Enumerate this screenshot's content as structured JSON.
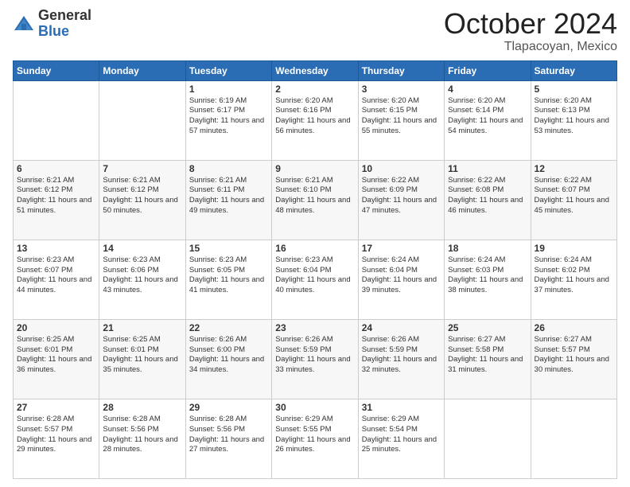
{
  "header": {
    "logo_general": "General",
    "logo_blue": "Blue",
    "month": "October 2024",
    "location": "Tlapacoyan, Mexico"
  },
  "days_of_week": [
    "Sunday",
    "Monday",
    "Tuesday",
    "Wednesday",
    "Thursday",
    "Friday",
    "Saturday"
  ],
  "weeks": [
    [
      {
        "day": "",
        "info": ""
      },
      {
        "day": "",
        "info": ""
      },
      {
        "day": "1",
        "info": "Sunrise: 6:19 AM\nSunset: 6:17 PM\nDaylight: 11 hours and 57 minutes."
      },
      {
        "day": "2",
        "info": "Sunrise: 6:20 AM\nSunset: 6:16 PM\nDaylight: 11 hours and 56 minutes."
      },
      {
        "day": "3",
        "info": "Sunrise: 6:20 AM\nSunset: 6:15 PM\nDaylight: 11 hours and 55 minutes."
      },
      {
        "day": "4",
        "info": "Sunrise: 6:20 AM\nSunset: 6:14 PM\nDaylight: 11 hours and 54 minutes."
      },
      {
        "day": "5",
        "info": "Sunrise: 6:20 AM\nSunset: 6:13 PM\nDaylight: 11 hours and 53 minutes."
      }
    ],
    [
      {
        "day": "6",
        "info": "Sunrise: 6:21 AM\nSunset: 6:12 PM\nDaylight: 11 hours and 51 minutes."
      },
      {
        "day": "7",
        "info": "Sunrise: 6:21 AM\nSunset: 6:12 PM\nDaylight: 11 hours and 50 minutes."
      },
      {
        "day": "8",
        "info": "Sunrise: 6:21 AM\nSunset: 6:11 PM\nDaylight: 11 hours and 49 minutes."
      },
      {
        "day": "9",
        "info": "Sunrise: 6:21 AM\nSunset: 6:10 PM\nDaylight: 11 hours and 48 minutes."
      },
      {
        "day": "10",
        "info": "Sunrise: 6:22 AM\nSunset: 6:09 PM\nDaylight: 11 hours and 47 minutes."
      },
      {
        "day": "11",
        "info": "Sunrise: 6:22 AM\nSunset: 6:08 PM\nDaylight: 11 hours and 46 minutes."
      },
      {
        "day": "12",
        "info": "Sunrise: 6:22 AM\nSunset: 6:07 PM\nDaylight: 11 hours and 45 minutes."
      }
    ],
    [
      {
        "day": "13",
        "info": "Sunrise: 6:23 AM\nSunset: 6:07 PM\nDaylight: 11 hours and 44 minutes."
      },
      {
        "day": "14",
        "info": "Sunrise: 6:23 AM\nSunset: 6:06 PM\nDaylight: 11 hours and 43 minutes."
      },
      {
        "day": "15",
        "info": "Sunrise: 6:23 AM\nSunset: 6:05 PM\nDaylight: 11 hours and 41 minutes."
      },
      {
        "day": "16",
        "info": "Sunrise: 6:23 AM\nSunset: 6:04 PM\nDaylight: 11 hours and 40 minutes."
      },
      {
        "day": "17",
        "info": "Sunrise: 6:24 AM\nSunset: 6:04 PM\nDaylight: 11 hours and 39 minutes."
      },
      {
        "day": "18",
        "info": "Sunrise: 6:24 AM\nSunset: 6:03 PM\nDaylight: 11 hours and 38 minutes."
      },
      {
        "day": "19",
        "info": "Sunrise: 6:24 AM\nSunset: 6:02 PM\nDaylight: 11 hours and 37 minutes."
      }
    ],
    [
      {
        "day": "20",
        "info": "Sunrise: 6:25 AM\nSunset: 6:01 PM\nDaylight: 11 hours and 36 minutes."
      },
      {
        "day": "21",
        "info": "Sunrise: 6:25 AM\nSunset: 6:01 PM\nDaylight: 11 hours and 35 minutes."
      },
      {
        "day": "22",
        "info": "Sunrise: 6:26 AM\nSunset: 6:00 PM\nDaylight: 11 hours and 34 minutes."
      },
      {
        "day": "23",
        "info": "Sunrise: 6:26 AM\nSunset: 5:59 PM\nDaylight: 11 hours and 33 minutes."
      },
      {
        "day": "24",
        "info": "Sunrise: 6:26 AM\nSunset: 5:59 PM\nDaylight: 11 hours and 32 minutes."
      },
      {
        "day": "25",
        "info": "Sunrise: 6:27 AM\nSunset: 5:58 PM\nDaylight: 11 hours and 31 minutes."
      },
      {
        "day": "26",
        "info": "Sunrise: 6:27 AM\nSunset: 5:57 PM\nDaylight: 11 hours and 30 minutes."
      }
    ],
    [
      {
        "day": "27",
        "info": "Sunrise: 6:28 AM\nSunset: 5:57 PM\nDaylight: 11 hours and 29 minutes."
      },
      {
        "day": "28",
        "info": "Sunrise: 6:28 AM\nSunset: 5:56 PM\nDaylight: 11 hours and 28 minutes."
      },
      {
        "day": "29",
        "info": "Sunrise: 6:28 AM\nSunset: 5:56 PM\nDaylight: 11 hours and 27 minutes."
      },
      {
        "day": "30",
        "info": "Sunrise: 6:29 AM\nSunset: 5:55 PM\nDaylight: 11 hours and 26 minutes."
      },
      {
        "day": "31",
        "info": "Sunrise: 6:29 AM\nSunset: 5:54 PM\nDaylight: 11 hours and 25 minutes."
      },
      {
        "day": "",
        "info": ""
      },
      {
        "day": "",
        "info": ""
      }
    ]
  ]
}
